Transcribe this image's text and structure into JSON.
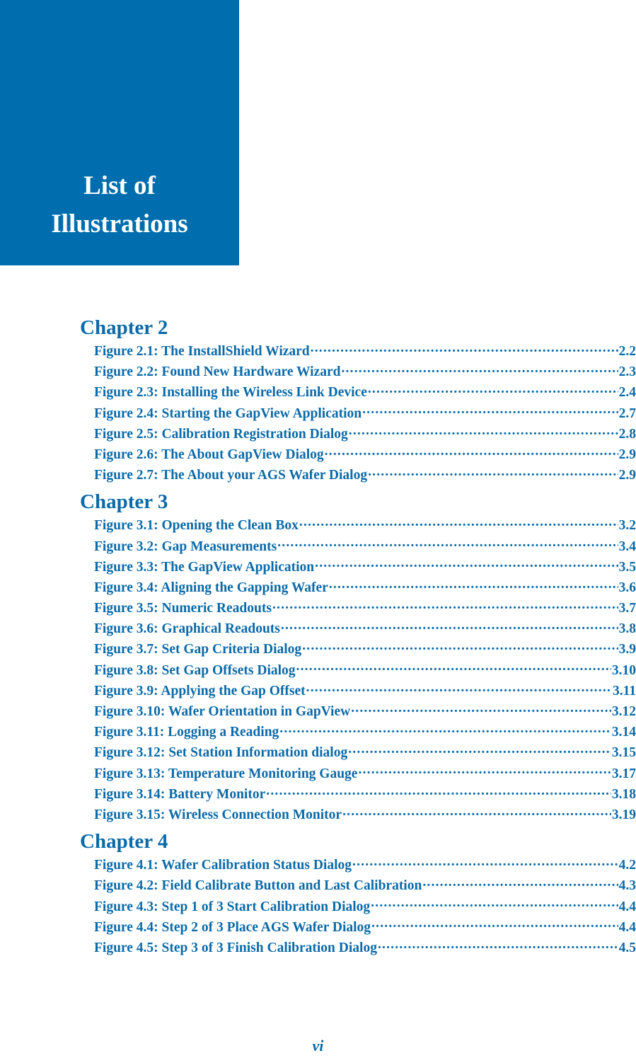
{
  "header": {
    "title_line1": "List of",
    "title_line2": "Illustrations",
    "block_color": "#006eae"
  },
  "accent_color": "#0b6aa8",
  "chapters": [
    {
      "heading": "Chapter 2",
      "entries": [
        {
          "label": "Figure 2.1: The InstallShield Wizard",
          "page": "2.2"
        },
        {
          "label": "Figure 2.2: Found New Hardware Wizard",
          "page": "2.3"
        },
        {
          "label": "Figure 2.3: Installing the Wireless Link Device",
          "page": "2.4"
        },
        {
          "label": "Figure 2.4: Starting the GapView Application",
          "page": "2.7"
        },
        {
          "label": "Figure 2.5: Calibration Registration Dialog",
          "page": "2.8"
        },
        {
          "label": "Figure 2.6: The About GapView Dialog",
          "page": "2.9"
        },
        {
          "label": "Figure 2.7: The About your AGS Wafer Dialog",
          "page": "2.9"
        }
      ]
    },
    {
      "heading": "Chapter 3",
      "entries": [
        {
          "label": "Figure 3.1: Opening the Clean Box",
          "page": "3.2"
        },
        {
          "label": "Figure 3.2: Gap Measurements",
          "page": "3.4"
        },
        {
          "label": "Figure 3.3: The GapView Application",
          "page": "3.5"
        },
        {
          "label": "Figure 3.4: Aligning the Gapping Wafer",
          "page": "3.6"
        },
        {
          "label": "Figure 3.5: Numeric Readouts",
          "page": "3.7"
        },
        {
          "label": "Figure 3.6: Graphical Readouts",
          "page": "3.8"
        },
        {
          "label": "Figure 3.7: Set Gap Criteria Dialog",
          "page": "3.9"
        },
        {
          "label": "Figure 3.8: Set Gap Offsets Dialog",
          "page": "3.10"
        },
        {
          "label": "Figure 3.9: Applying the Gap Offset",
          "page": "3.11"
        },
        {
          "label": "Figure 3.10: Wafer Orientation in GapView",
          "page": "3.12"
        },
        {
          "label": "Figure 3.11: Logging a Reading",
          "page": "3.14"
        },
        {
          "label": "Figure 3.12: Set Station Information dialog",
          "page": "3.15"
        },
        {
          "label": "Figure 3.13: Temperature Monitoring Gauge",
          "page": "3.17"
        },
        {
          "label": "Figure 3.14: Battery Monitor",
          "page": "3.18"
        },
        {
          "label": "Figure 3.15: Wireless Connection Monitor",
          "page": "3.19"
        }
      ]
    },
    {
      "heading": "Chapter 4",
      "entries": [
        {
          "label": "Figure 4.1: Wafer Calibration Status Dialog",
          "page": "4.2"
        },
        {
          "label": "Figure 4.2: Field Calibrate Button and Last Calibration",
          "page": "4.3"
        },
        {
          "label": "Figure 4.3: Step 1 of 3 Start Calibration Dialog",
          "page": "4.4"
        },
        {
          "label": "Figure 4.4: Step 2 of 3 Place AGS Wafer Dialog",
          "page": "4.4"
        },
        {
          "label": "Figure 4.5: Step 3 of 3 Finish Calibration Dialog",
          "page": "4.5"
        }
      ]
    }
  ],
  "footer": {
    "page_number": "vi"
  }
}
